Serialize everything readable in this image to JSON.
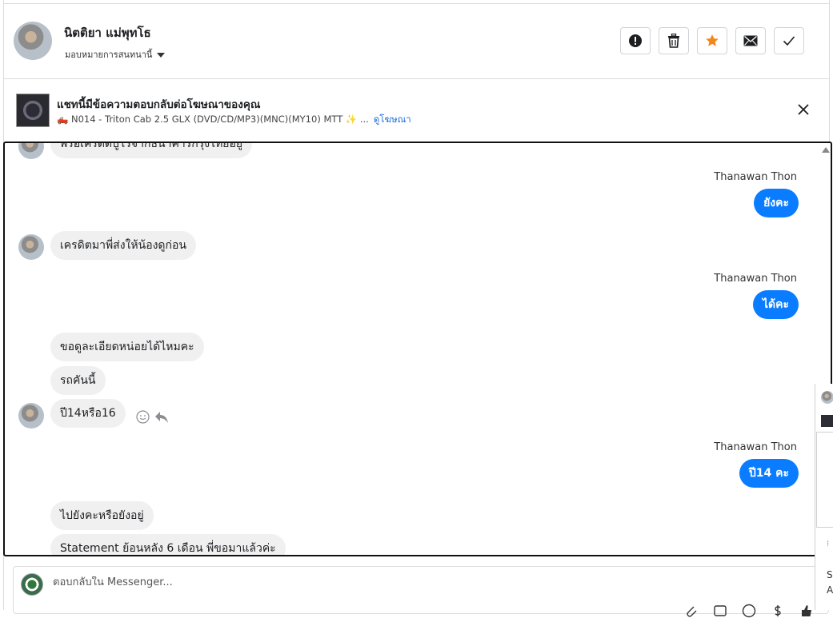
{
  "header": {
    "contact_name": "นิตติยา แม่พุทโธ",
    "assign_label": "มอบหมายการสนทนานี้",
    "buttons": [
      {
        "name": "report",
        "icon": "exclamation-circle-icon"
      },
      {
        "name": "delete",
        "icon": "trash-icon"
      },
      {
        "name": "star",
        "icon": "star-icon",
        "color": "#f2871c"
      },
      {
        "name": "mark-unread",
        "icon": "envelope-icon"
      },
      {
        "name": "done",
        "icon": "checkmark-icon"
      }
    ]
  },
  "ad_banner": {
    "title": "แชทนี้มีข้อความตอบกลับต่อโฆษณาของคุณ",
    "subtitle": "🛻 N014 - Triton Cab 2.5 GLX (DVD/CD/MP3)(MNC)(MY10) MTT ✨ ...",
    "link": "ดูโฆษณา"
  },
  "messages": {
    "m0": "พร้อเครดิตบูโรจากธนาคารกรุงไทยอยู่",
    "s1": "Thanawan Thon",
    "m1": "ยังคะ",
    "m2": "เครดิตมาพี่ส่งให้น้องดูก่อน",
    "s2": "Thanawan Thon",
    "m3": "ได้คะ",
    "m4": "ขอดูละเอียดหน่อยได้ไหมคะ",
    "m5": "รถคันนี้",
    "m6": "ปี14หรือ16",
    "s3": "Thanawan Thon",
    "m7": "ปี14 คะ",
    "m8": "ไปยังคะหรือยังอยู่",
    "m9": "Statement ย้อนหลัง 6 เดือน พี่ขอมาแล้วค่ะ"
  },
  "reply": {
    "placeholder": "ตอบกลับใน Messenger..."
  },
  "side": {
    "s": "S",
    "a": "A"
  },
  "colors": {
    "outgoing_bubble": "#0a7cff",
    "incoming_bubble": "#f0f0f0",
    "link": "#216fdb",
    "star": "#f2871c"
  }
}
